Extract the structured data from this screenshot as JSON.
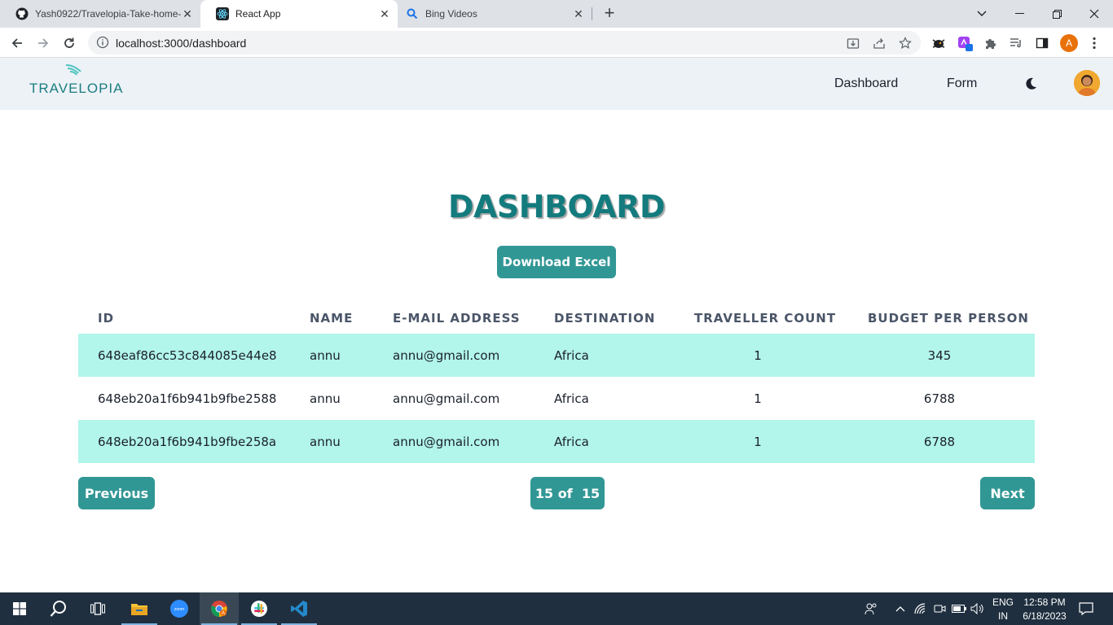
{
  "browser": {
    "tabs": [
      {
        "title": "Yash0922/Travelopia-Take-home-",
        "icon": "github-icon",
        "active": false
      },
      {
        "title": "React App",
        "icon": "react-icon",
        "active": true
      },
      {
        "title": "Bing Videos",
        "icon": "search-icon",
        "active": false
      }
    ],
    "url": "localhost:3000/dashboard",
    "profile_initial": "A"
  },
  "app": {
    "logo_text": "TRAVELOPIA",
    "nav": {
      "dashboard": "Dashboard",
      "form": "Form"
    }
  },
  "main": {
    "title": "DASHBOARD",
    "download_label": "Download Excel",
    "table": {
      "headers": [
        "ID",
        "NAME",
        "E-MAIL ADDRESS",
        "DESTINATION",
        "TRAVELLER COUNT",
        "BUDGET PER PERSON"
      ],
      "rows": [
        {
          "id": "648eaf86cc53c844085e44e8",
          "name": "annu",
          "email": "annu@gmail.com",
          "destination": "Africa",
          "count": "1",
          "budget": "345"
        },
        {
          "id": "648eb20a1f6b941b9fbe2588",
          "name": "annu",
          "email": "annu@gmail.com",
          "destination": "Africa",
          "count": "1",
          "budget": "6788"
        },
        {
          "id": "648eb20a1f6b941b9fbe258a",
          "name": "annu",
          "email": "annu@gmail.com",
          "destination": "Africa",
          "count": "1",
          "budget": "6788"
        }
      ]
    },
    "pagination": {
      "previous_label": "Previous",
      "page_text": "15 of  15",
      "next_label": "Next"
    }
  },
  "taskbar": {
    "language_top": "ENG",
    "language_bottom": "IN",
    "time": "12:58 PM",
    "date": "6/18/2023"
  },
  "colors": {
    "accent": "#319795",
    "stripe": "#b2f5ea",
    "title": "#137b7e",
    "navbar_bg": "#edf2f7"
  }
}
